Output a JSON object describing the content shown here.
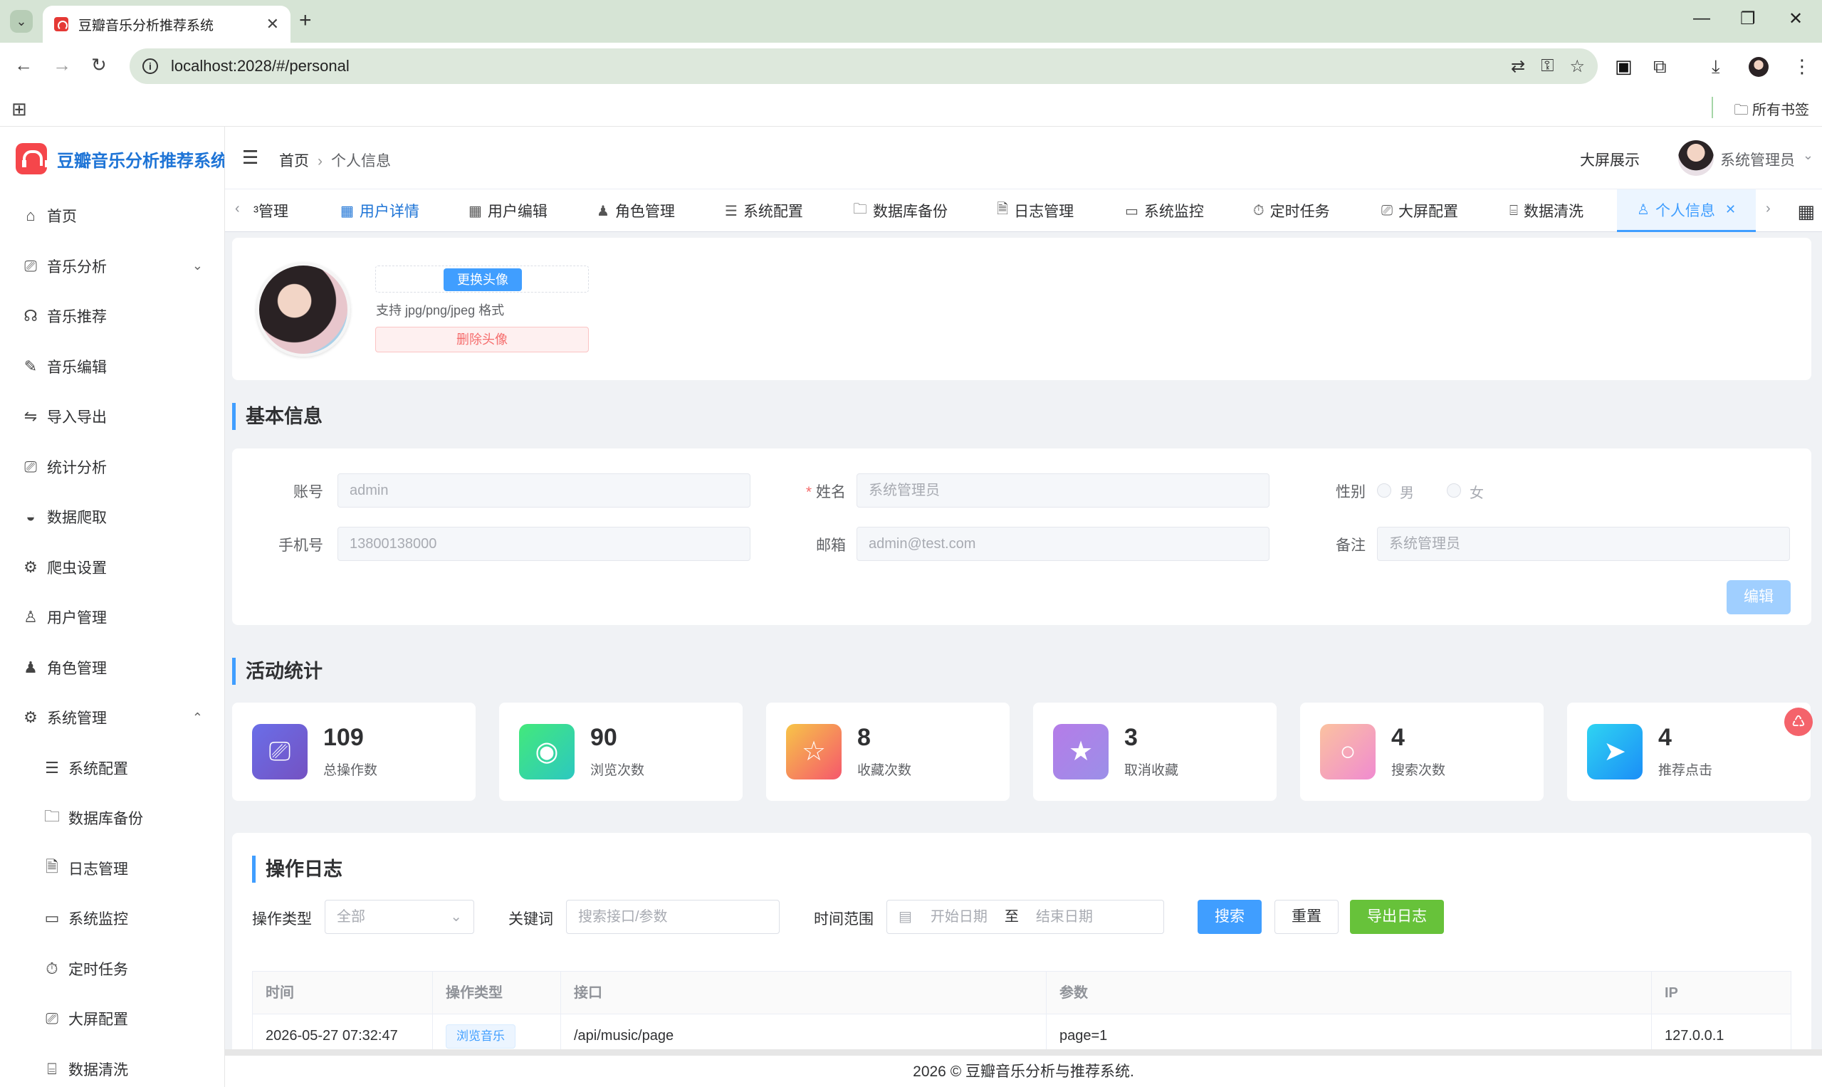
{
  "browser": {
    "tab_title": "豆瓣音乐分析推荐系统",
    "url": "localhost:2028/#/personal",
    "bookmarks_label": "所有书签"
  },
  "app": {
    "logo_text": "豆瓣音乐分析推荐系统",
    "sidebar": {
      "items": [
        {
          "label": "首页",
          "icon": "home-icon"
        },
        {
          "label": "音乐分析",
          "icon": "monitor-icon"
        },
        {
          "label": "音乐推荐",
          "icon": "headphones-icon"
        },
        {
          "label": "音乐编辑",
          "icon": "edit-icon"
        },
        {
          "label": "导入导出",
          "icon": "switch-icon"
        },
        {
          "label": "统计分析",
          "icon": "chart-icon"
        },
        {
          "label": "数据爬取",
          "icon": "bowl-icon"
        },
        {
          "label": "爬虫设置",
          "icon": "gear-icon"
        },
        {
          "label": "用户管理",
          "icon": "user-icon"
        },
        {
          "label": "角色管理",
          "icon": "avatar-icon"
        },
        {
          "label": "系统管理",
          "icon": "gear-icon"
        },
        {
          "label": "系统配置",
          "icon": "sliders-icon"
        },
        {
          "label": "数据库备份",
          "icon": "folder-icon"
        },
        {
          "label": "日志管理",
          "icon": "document-icon"
        },
        {
          "label": "系统监控",
          "icon": "monitor-icon"
        },
        {
          "label": "定时任务",
          "icon": "timer-icon"
        },
        {
          "label": "大屏配置",
          "icon": "screen-icon"
        },
        {
          "label": "数据清洗",
          "icon": "brush-icon"
        }
      ]
    },
    "header": {
      "breadcrumb_home": "首页",
      "breadcrumb_current": "个人信息",
      "big_screen": "大屏展示",
      "user_name": "系统管理员"
    },
    "tags": [
      "³管理",
      "用户详情",
      "用户编辑",
      "角色管理",
      "系统配置",
      "数据库备份",
      "日志管理",
      "系统监控",
      "定时任务",
      "大屏配置",
      "数据清洗",
      "个人信息"
    ],
    "avatar": {
      "upload_label": "更换头像",
      "tip": "支持 jpg/png/jpeg 格式",
      "delete_label": "删除头像"
    },
    "basic_info": {
      "title": "基本信息",
      "account_label": "账号",
      "account_value": "admin",
      "name_label": "姓名",
      "name_value": "系统管理员",
      "gender_label": "性别",
      "gender_male": "男",
      "gender_female": "女",
      "phone_label": "手机号",
      "phone_value": "13800138000",
      "email_label": "邮箱",
      "email_value": "admin@test.com",
      "remark_label": "备注",
      "remark_value": "系统管理员",
      "edit_label": "编辑"
    },
    "activity": {
      "title": "活动统计",
      "stats": [
        {
          "value": "109",
          "label": "总操作数",
          "color": "#7367f0"
        },
        {
          "value": "90",
          "label": "浏览次数",
          "color": "#2ed8b6"
        },
        {
          "value": "8",
          "label": "收藏次数",
          "color": "#ff6b8b"
        },
        {
          "value": "3",
          "label": "取消收藏",
          "color": "#a78bfa"
        },
        {
          "value": "4",
          "label": "搜索次数",
          "color": "#f3a3c6"
        },
        {
          "value": "4",
          "label": "推荐点击",
          "color": "#1eb3f7"
        }
      ]
    },
    "logs": {
      "title": "操作日志",
      "type_label": "操作类型",
      "type_value": "全部",
      "keyword_label": "关键词",
      "keyword_placeholder": "搜索接口/参数",
      "range_label": "时间范围",
      "start_placeholder": "开始日期",
      "range_sep": "至",
      "end_placeholder": "结束日期",
      "search_label": "搜索",
      "reset_label": "重置",
      "export_label": "导出日志",
      "columns": [
        "时间",
        "操作类型",
        "接口",
        "参数",
        "IP"
      ],
      "rows": [
        {
          "time": "2026-05-27 07:32:47",
          "type": "浏览音乐",
          "api": "/api/music/page",
          "params": "page=1",
          "ip": "127.0.0.1"
        }
      ]
    },
    "footer": "2026 © 豆瓣音乐分析与推荐系统."
  }
}
